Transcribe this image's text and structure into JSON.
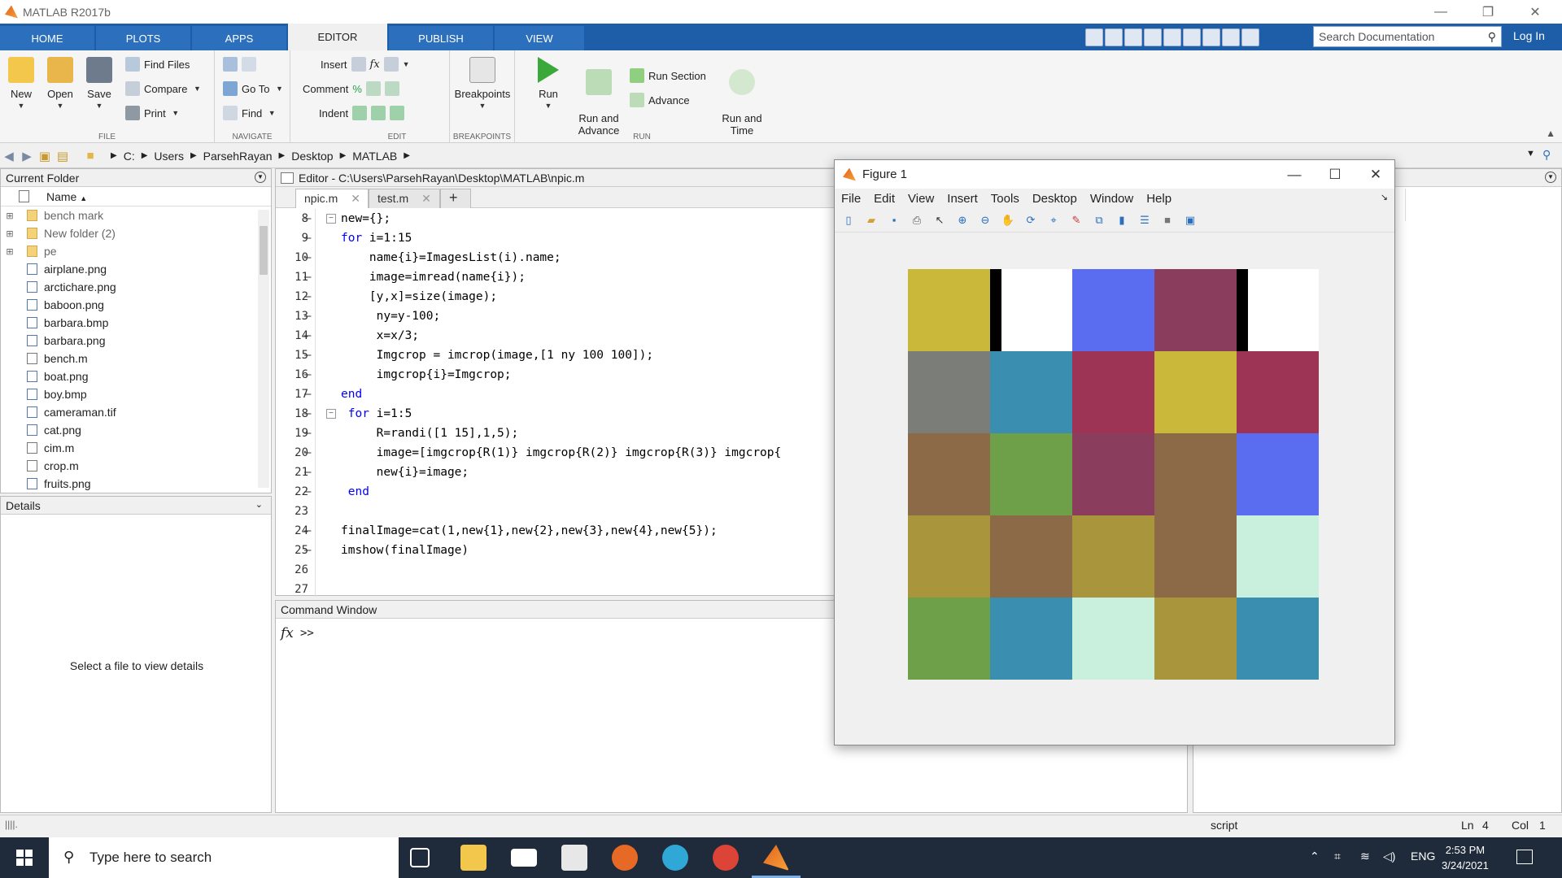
{
  "window": {
    "title": "MATLAB R2017b"
  },
  "ribbon_tabs": [
    "HOME",
    "PLOTS",
    "APPS",
    "EDITOR",
    "PUBLISH",
    "VIEW"
  ],
  "active_tab": "EDITOR",
  "search": {
    "placeholder": "Search Documentation"
  },
  "login": "Log In",
  "ribbon": {
    "file": {
      "label": "FILE",
      "new": "New",
      "open": "Open",
      "save": "Save",
      "find_files": "Find Files",
      "compare": "Compare",
      "print": "Print"
    },
    "navigate": {
      "label": "NAVIGATE",
      "go_to": "Go To",
      "find": "Find"
    },
    "edit": {
      "label": "EDIT",
      "insert": "Insert",
      "comment": "Comment",
      "indent": "Indent"
    },
    "breakpoints": {
      "label": "BREAKPOINTS",
      "breakpoints": "Breakpoints"
    },
    "run": {
      "label": "RUN",
      "run": "Run",
      "run_and_advance": "Run and\nAdvance",
      "run_section": "Run Section",
      "advance": "Advance",
      "run_and_time": "Run and\nTime"
    }
  },
  "address": {
    "crumbs": [
      "C:",
      "Users",
      "ParsehRayan",
      "Desktop",
      "MATLAB"
    ]
  },
  "current_folder": {
    "title": "Current Folder",
    "column": "Name",
    "items": [
      {
        "name": "bench mark",
        "type": "folder"
      },
      {
        "name": "New folder (2)",
        "type": "folder"
      },
      {
        "name": "pe",
        "type": "folder"
      },
      {
        "name": "airplane.png",
        "type": "image"
      },
      {
        "name": "arctichare.png",
        "type": "image"
      },
      {
        "name": "baboon.png",
        "type": "image"
      },
      {
        "name": "barbara.bmp",
        "type": "image"
      },
      {
        "name": "barbara.png",
        "type": "image"
      },
      {
        "name": "bench.m",
        "type": "m"
      },
      {
        "name": "boat.png",
        "type": "image"
      },
      {
        "name": "boy.bmp",
        "type": "image"
      },
      {
        "name": "cameraman.tif",
        "type": "image"
      },
      {
        "name": "cat.png",
        "type": "image"
      },
      {
        "name": "cim.m",
        "type": "m"
      },
      {
        "name": "crop.m",
        "type": "m"
      },
      {
        "name": "fruits.png",
        "type": "image"
      }
    ]
  },
  "details": {
    "title": "Details",
    "message": "Select a file to view details"
  },
  "editor": {
    "title": "Editor - C:\\Users\\ParsehRayan\\Desktop\\MATLAB\\npic.m",
    "tabs": [
      "npic.m",
      "test.m"
    ],
    "active_tab": "npic.m",
    "lines": [
      {
        "n": "8",
        "code": "new={};"
      },
      {
        "n": "9",
        "code": "for i=1:15"
      },
      {
        "n": "10",
        "code": "    name{i}=ImagesList(i).name;"
      },
      {
        "n": "11",
        "code": "    image=imread(name{i});"
      },
      {
        "n": "12",
        "code": "    [y,x]=size(image);"
      },
      {
        "n": "13",
        "code": "     ny=y-100;"
      },
      {
        "n": "14",
        "code": "     x=x/3;"
      },
      {
        "n": "15",
        "code": "     Imgcrop = imcrop(image,[1 ny 100 100]);"
      },
      {
        "n": "16",
        "code": "     imgcrop{i}=Imgcrop;"
      },
      {
        "n": "17",
        "code": "end"
      },
      {
        "n": "18",
        "code": " for i=1:5"
      },
      {
        "n": "19",
        "code": "     R=randi([1 15],1,5);"
      },
      {
        "n": "20",
        "code": "     image=[imgcrop{R(1)} imgcrop{R(2)} imgcrop{R(3)} imgcrop{"
      },
      {
        "n": "21",
        "code": "     new{i}=image;"
      },
      {
        "n": "22",
        "code": " end"
      },
      {
        "n": "23",
        "code": ""
      },
      {
        "n": "24",
        "code": "finalImage=cat(1,new{1},new{2},new{3},new{4},new{5});"
      },
      {
        "n": "25",
        "code": "imshow(finalImage)"
      },
      {
        "n": "26",
        "code": ""
      },
      {
        "n": "27",
        "code": ""
      }
    ]
  },
  "command_window": {
    "title": "Command Window",
    "prompt": ">>"
  },
  "figure": {
    "title": "Figure 1",
    "menu": [
      "File",
      "Edit",
      "View",
      "Insert",
      "Tools",
      "Desktop",
      "Window",
      "Help"
    ],
    "tiles": [
      [
        "#c9b83a",
        "#000000",
        "#5a6cf0",
        "#8a3d5c",
        "#000000"
      ],
      [
        "#7a7d78",
        "#3a8fb0",
        "#9e3455",
        "#c9b83a",
        "#9e3455"
      ],
      [
        "#8c6a48",
        "#6ea04a",
        "#8a3d5c",
        "#8c6a48",
        "#5a6cf0"
      ],
      [
        "#a9963c",
        "#8c6a48",
        "#a9963c",
        "#8c6a48",
        "#c8f0dc"
      ],
      [
        "#6ea04a",
        "#3a8fb0",
        "#c8f0dc",
        "#a9963c",
        "#3a8fb0"
      ]
    ]
  },
  "status": {
    "mode": "script",
    "ln": "Ln",
    "ln_val": "4",
    "col": "Col",
    "col_val": "1"
  },
  "taskbar": {
    "search_placeholder": "Type here to search",
    "lang": "ENG",
    "time": "2:53 PM",
    "date": "3/24/2021"
  }
}
